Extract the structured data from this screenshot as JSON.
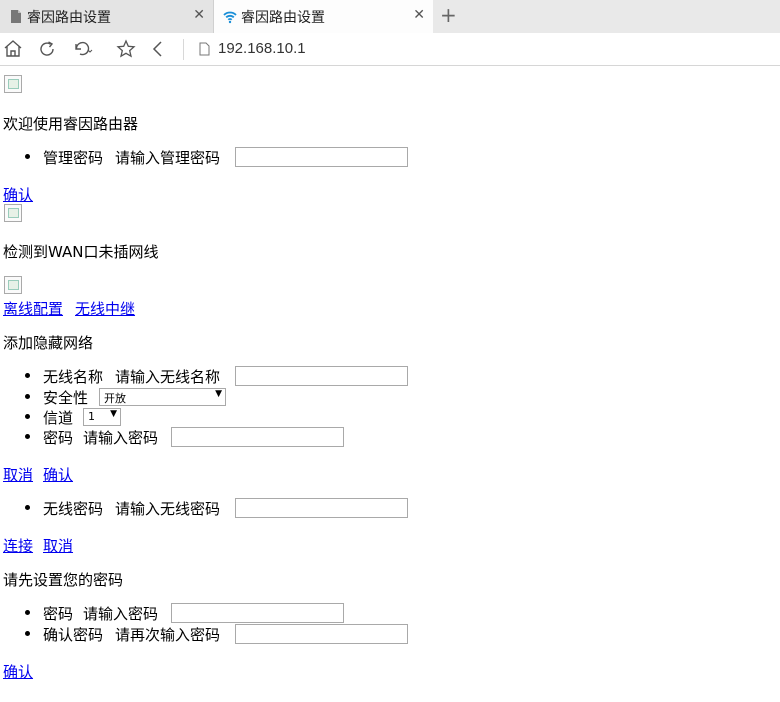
{
  "browser": {
    "tabs": [
      {
        "title": "睿因路由设置",
        "close": "✕"
      },
      {
        "title": "睿因路由设置",
        "close": "✕"
      }
    ],
    "new_tab": "+",
    "address": "192.168.10.1"
  },
  "page": {
    "welcome": "欢迎使用睿因路由器",
    "admin_pw": {
      "label": "管理密码",
      "hint": "请输入管理密码"
    },
    "confirm1": "确认",
    "wan_notice": "检测到WAN口未插网线",
    "offline_config": "离线配置",
    "wireless_repeater": "无线中继",
    "add_hidden": "添加隐藏网络",
    "ssid": {
      "label": "无线名称",
      "hint": "请输入无线名称"
    },
    "security": {
      "label": "安全性",
      "value": "开放"
    },
    "channel": {
      "label": "信道",
      "value": "1"
    },
    "password": {
      "label": "密码",
      "hint": "请输入密码"
    },
    "cancel1": "取消",
    "confirm2": "确认",
    "wifi_pw": {
      "label": "无线密码",
      "hint": "请输入无线密码"
    },
    "connect": "连接",
    "cancel2": "取消",
    "set_pw_title": "请先设置您的密码",
    "new_pw": {
      "label": "密码",
      "hint": "请输入密码"
    },
    "confirm_pw": {
      "label": "确认密码",
      "hint": "请再次输入密码"
    },
    "confirm3": "确认"
  }
}
